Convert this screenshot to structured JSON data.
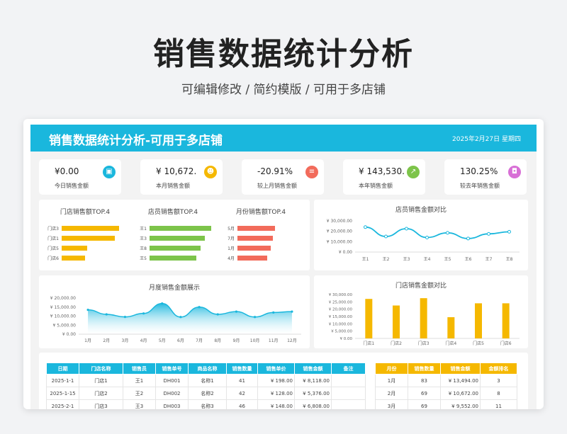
{
  "hero": {
    "title": "销售数据统计分析",
    "subtitle": "可编辑修改 / 简约模版 / 可用于多店铺"
  },
  "banner": {
    "title": "销售数据统计分析-可用于多店铺",
    "date": "2025年2月27日  星期四"
  },
  "kpis": [
    {
      "value": "¥0.00",
      "label": "今日销售金额",
      "icon": "bag-icon",
      "color": "#1ab7dd"
    },
    {
      "value": "¥ 10,672.",
      "label": "本月销售金额",
      "icon": "users-icon",
      "color": "#f5b800"
    },
    {
      "value": "-20.91%",
      "label": "较上月销售金额",
      "icon": "chart-list-icon",
      "color": "#f26b5b"
    },
    {
      "value": "¥ 143,530.",
      "label": "本年销售金额",
      "icon": "growth-icon",
      "color": "#7dc44a"
    },
    {
      "value": "130.25%",
      "label": "较去年销售金额",
      "icon": "gift-icon",
      "color": "#d86fd6"
    }
  ],
  "colors": {
    "blue": "#1ab7dd",
    "orange": "#f5b800",
    "green": "#7dc44a",
    "red": "#f26b5b"
  },
  "top4": [
    {
      "title": "门店销售额TOP.4",
      "color": "#f5b800",
      "labels": [
        "门店3",
        "门店1",
        "门店5",
        "门店6"
      ],
      "values": [
        27000,
        25000,
        12000,
        11000
      ]
    },
    {
      "title": "店员销售额TOP.4",
      "color": "#7dc44a",
      "labels": [
        "王1",
        "王3",
        "王8",
        "王5"
      ],
      "values": [
        29000,
        26000,
        24000,
        22000
      ]
    },
    {
      "title": "月份销售额TOP.4",
      "color": "#f26b5b",
      "labels": [
        "5月",
        "7月",
        "1月",
        "4月"
      ],
      "values": [
        17500,
        16500,
        15500,
        14000
      ]
    }
  ],
  "chart_data": [
    {
      "type": "line",
      "title": "店员销售金额对比",
      "categories": [
        "王1",
        "王2",
        "王3",
        "王4",
        "王5",
        "王6",
        "王7",
        "王8"
      ],
      "values": [
        24000,
        15000,
        22500,
        14000,
        18500,
        13000,
        17500,
        19500
      ],
      "ylim": [
        0,
        30000
      ],
      "yticks": [
        "¥ 30,000.00",
        "¥ 20,000.00",
        "¥ 10,000.00",
        "¥ 0.00"
      ],
      "color": "#1ab7dd"
    },
    {
      "type": "area",
      "title": "月度销售金额展示",
      "categories": [
        "1月",
        "2月",
        "3月",
        "4月",
        "5月",
        "6月",
        "7月",
        "8月",
        "9月",
        "10月",
        "11月",
        "12月"
      ],
      "values": [
        13500,
        11000,
        9552,
        11500,
        17000,
        9500,
        15000,
        11000,
        12500,
        9500,
        12000,
        12500
      ],
      "ylim": [
        0,
        20000
      ],
      "yticks": [
        "¥ 20,000.00",
        "¥ 15,000.00",
        "¥ 10,000.00",
        "¥ 5,000.00",
        "¥ 0.00"
      ],
      "color": "#1ab7dd"
    },
    {
      "type": "bar",
      "title": "门店销售金额对比",
      "categories": [
        "门店1",
        "门店2",
        "门店3",
        "门店4",
        "门店5",
        "门店6"
      ],
      "values": [
        27000,
        22500,
        27500,
        14500,
        24000,
        24000
      ],
      "ylim": [
        0,
        30000
      ],
      "yticks": [
        "¥ 30,000.00",
        "¥ 25,000.00",
        "¥ 20,000.00",
        "¥ 15,000.00",
        "¥ 10,000.00",
        "¥ 5,000.00",
        "¥ 0.00"
      ],
      "color": "#f5b800"
    }
  ],
  "sales_table": {
    "headers": [
      "日期",
      "门店名称",
      "销售员",
      "销售单号",
      "商品名称",
      "销售数量",
      "销售单价",
      "销售金额",
      "备注"
    ],
    "rows": [
      [
        "2025-1-1",
        "门店1",
        "王1",
        "DH001",
        "名称1",
        "41",
        "¥ 198.00",
        "¥ 8,118.00",
        ""
      ],
      [
        "2025-1-15",
        "门店2",
        "王2",
        "DH002",
        "名称2",
        "42",
        "¥ 128.00",
        "¥ 5,376.00",
        ""
      ],
      [
        "2025-2-1",
        "门店3",
        "王3",
        "DH003",
        "名称3",
        "46",
        "¥ 148.00",
        "¥ 6,808.00",
        ""
      ]
    ]
  },
  "month_table": {
    "headers": [
      "月份",
      "销售数量",
      "销售金额",
      "金额排名"
    ],
    "rows": [
      [
        "1月",
        "83",
        "¥ 13,494.00",
        "3"
      ],
      [
        "2月",
        "69",
        "¥ 10,672.00",
        "8"
      ],
      [
        "3月",
        "69",
        "¥ 9,552.00",
        "11"
      ]
    ]
  }
}
